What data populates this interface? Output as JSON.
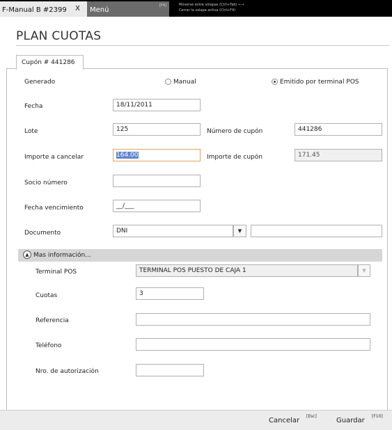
{
  "tabs": {
    "document_tab": "F-Manual B #2399",
    "close": "X",
    "menu_tab": "Menú",
    "menu_key": "[F4]",
    "hint_line1": "Moverse entre solapas (Ctrl+Tab) ←→",
    "hint_line2": "Cerrar la solapa activa (Ctrl+F4)"
  },
  "page": {
    "title": "PLAN CUOTAS"
  },
  "coupon_tab": "Cupón # 441286",
  "form": {
    "generado": {
      "label": "Generado",
      "options": [
        "Manual",
        "Emitido por terminal POS"
      ],
      "selected": "Emitido por terminal POS"
    },
    "fecha": {
      "label": "Fecha",
      "value": "18/11/2011"
    },
    "lote": {
      "label": "Lote",
      "value": "125"
    },
    "numero_cupon": {
      "label": "Número de cupón",
      "value": "441286"
    },
    "importe_cancelar": {
      "label": "Importe a cancelar",
      "value": "164.00"
    },
    "importe_cupon": {
      "label": "Importe de cupón",
      "value": "171.45"
    },
    "socio_numero": {
      "label": "Socio número",
      "value": ""
    },
    "fecha_vencimiento": {
      "label": "Fecha vencimiento",
      "value": "__/___"
    },
    "documento": {
      "label": "Documento",
      "type_value": "DNI",
      "number_value": ""
    }
  },
  "more_info": {
    "toggle_label": "Mas información...",
    "terminal_pos": {
      "label": "Terminal POS",
      "value": "TERMINAL POS PUESTO DE CAJA 1"
    },
    "cuotas": {
      "label": "Cuotas",
      "value": "3"
    },
    "referencia": {
      "label": "Referencia",
      "value": ""
    },
    "telefono": {
      "label": "Teléfono",
      "value": ""
    },
    "nro_autorizacion": {
      "label": "Nro. de autorización",
      "value": ""
    }
  },
  "footer": {
    "cancel_label": "Cancelar",
    "cancel_key": "[Esc]",
    "save_label": "Guardar",
    "save_key": "[F10]"
  },
  "colors": {
    "selection": "#6186c8",
    "active_border": "#e0a45d",
    "top_bar": "#000000"
  },
  "icons": {
    "dropdown": "triangle-down",
    "collapse": "chevron-up-circle",
    "radio": "radio-button"
  }
}
